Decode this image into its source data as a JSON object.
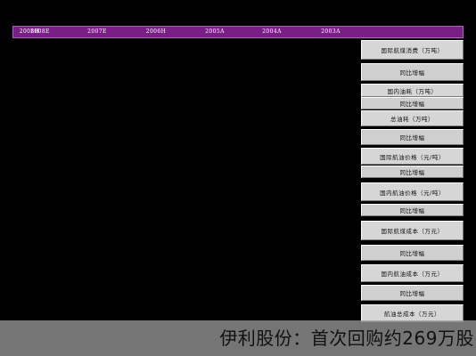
{
  "header": {
    "columns": [
      "2008H",
      "2008E",
      "2007E",
      "2006H",
      "2005A",
      "2004A",
      "2003A"
    ]
  },
  "rows": [
    "国际航煤消费（万吨）",
    "同比增幅",
    "国内油耗（万吨）",
    "同比增幅",
    "总油耗（万吨）",
    "同比增幅",
    "国际航油价格（元/吨）",
    "同比增幅",
    "国内航油价格（元/吨）",
    "同比增幅",
    "国际航煤成本（万元）",
    "同比增幅",
    "国内航油成本（万元）",
    "同比增幅",
    "航油总成本（万元）"
  ],
  "caption": {
    "text": "伊利股份：首次回购约269万股"
  },
  "colors": {
    "header_bg": "#7a1f86",
    "row_bg": "#d6d6d6",
    "background": "#000000",
    "caption_bg": "#969696"
  }
}
